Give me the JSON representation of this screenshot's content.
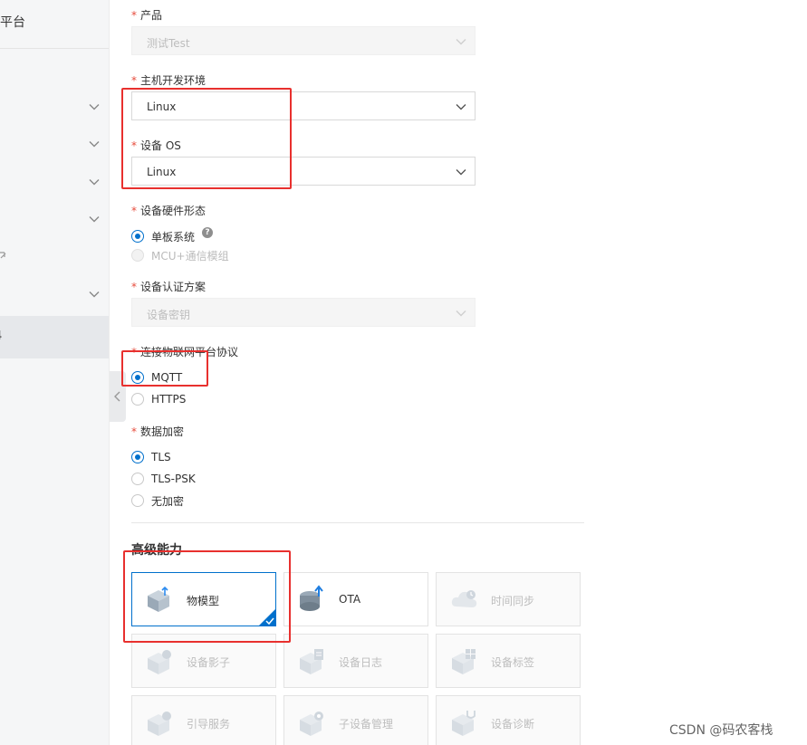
{
  "sidebar": {
    "title": "平台",
    "active_item": "4"
  },
  "form": {
    "product": {
      "label": "产品",
      "value": "测试Test"
    },
    "host_env": {
      "label": "主机开发环境",
      "value": "Linux"
    },
    "device_os": {
      "label": "设备 OS",
      "value": "Linux"
    },
    "hardware": {
      "label": "设备硬件形态",
      "options": [
        "单板系统",
        "MCU+通信模组"
      ],
      "selected": "单板系统",
      "help": "?"
    },
    "auth": {
      "label": "设备认证方案",
      "value": "设备密钥"
    },
    "protocol": {
      "label": "连接物联网平台协议",
      "options": [
        "MQTT",
        "HTTPS"
      ],
      "selected": "MQTT"
    },
    "encryption": {
      "label": "数据加密",
      "options": [
        "TLS",
        "TLS-PSK",
        "无加密"
      ],
      "selected": "TLS"
    }
  },
  "advanced": {
    "title": "高级能力",
    "cards": [
      {
        "label": "物模型",
        "icon": "thing-model-icon",
        "state": "selected"
      },
      {
        "label": "OTA",
        "icon": "ota-icon",
        "state": "enabled"
      },
      {
        "label": "时间同步",
        "icon": "time-sync-icon",
        "state": "disabled"
      },
      {
        "label": "设备影子",
        "icon": "device-shadow-icon",
        "state": "disabled"
      },
      {
        "label": "设备日志",
        "icon": "device-log-icon",
        "state": "disabled"
      },
      {
        "label": "设备标签",
        "icon": "device-tag-icon",
        "state": "disabled"
      },
      {
        "label": "引导服务",
        "icon": "bootstrap-icon",
        "state": "disabled"
      },
      {
        "label": "子设备管理",
        "icon": "sub-device-icon",
        "state": "disabled"
      },
      {
        "label": "设备诊断",
        "icon": "diagnosis-icon",
        "state": "disabled"
      }
    ]
  },
  "watermark": "CSDN @码农客栈",
  "colors": {
    "primary": "#0070cc",
    "required": "#e74c3c",
    "annotation": "#e8302e"
  }
}
